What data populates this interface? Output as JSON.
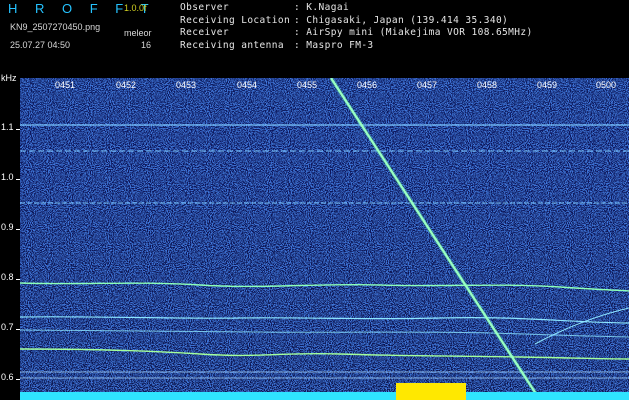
{
  "header": {
    "brand": "H R O F F T",
    "version": "1.0.0f",
    "filename": "KN9_2507270450.png",
    "param_label": "meleor",
    "param_value": "16",
    "timestamp": "25.07.27 04:50"
  },
  "info": [
    {
      "label": "Observer",
      "value": ": K.Nagai"
    },
    {
      "label": "Receiving Location",
      "value": ": Chigasaki, Japan (139.414 35.340)"
    },
    {
      "label": "Receiver",
      "value": ": AirSpy mini (Miakejima VOR 108.65MHz)"
    },
    {
      "label": "Receiving antenna",
      "value": ": Maspro FM-3"
    }
  ],
  "axis": {
    "y_unit": "kHz",
    "y_ticks": [
      "1.1",
      "1.0",
      "0.9",
      "0.8",
      "0.7",
      "0.6"
    ],
    "x_ticks": [
      "0451",
      "0452",
      "0453",
      "0454",
      "0455",
      "0456",
      "0457",
      "0458",
      "0459",
      "0500"
    ]
  },
  "colors": {
    "background": "#000000",
    "noise_low": "#0d1e6a",
    "noise_high": "#3a7cff",
    "signal": "#7dffb0",
    "brand": "#25c3ff",
    "bottom_band": "#2fe4ff",
    "bottom_peak": "#ffe800"
  }
}
